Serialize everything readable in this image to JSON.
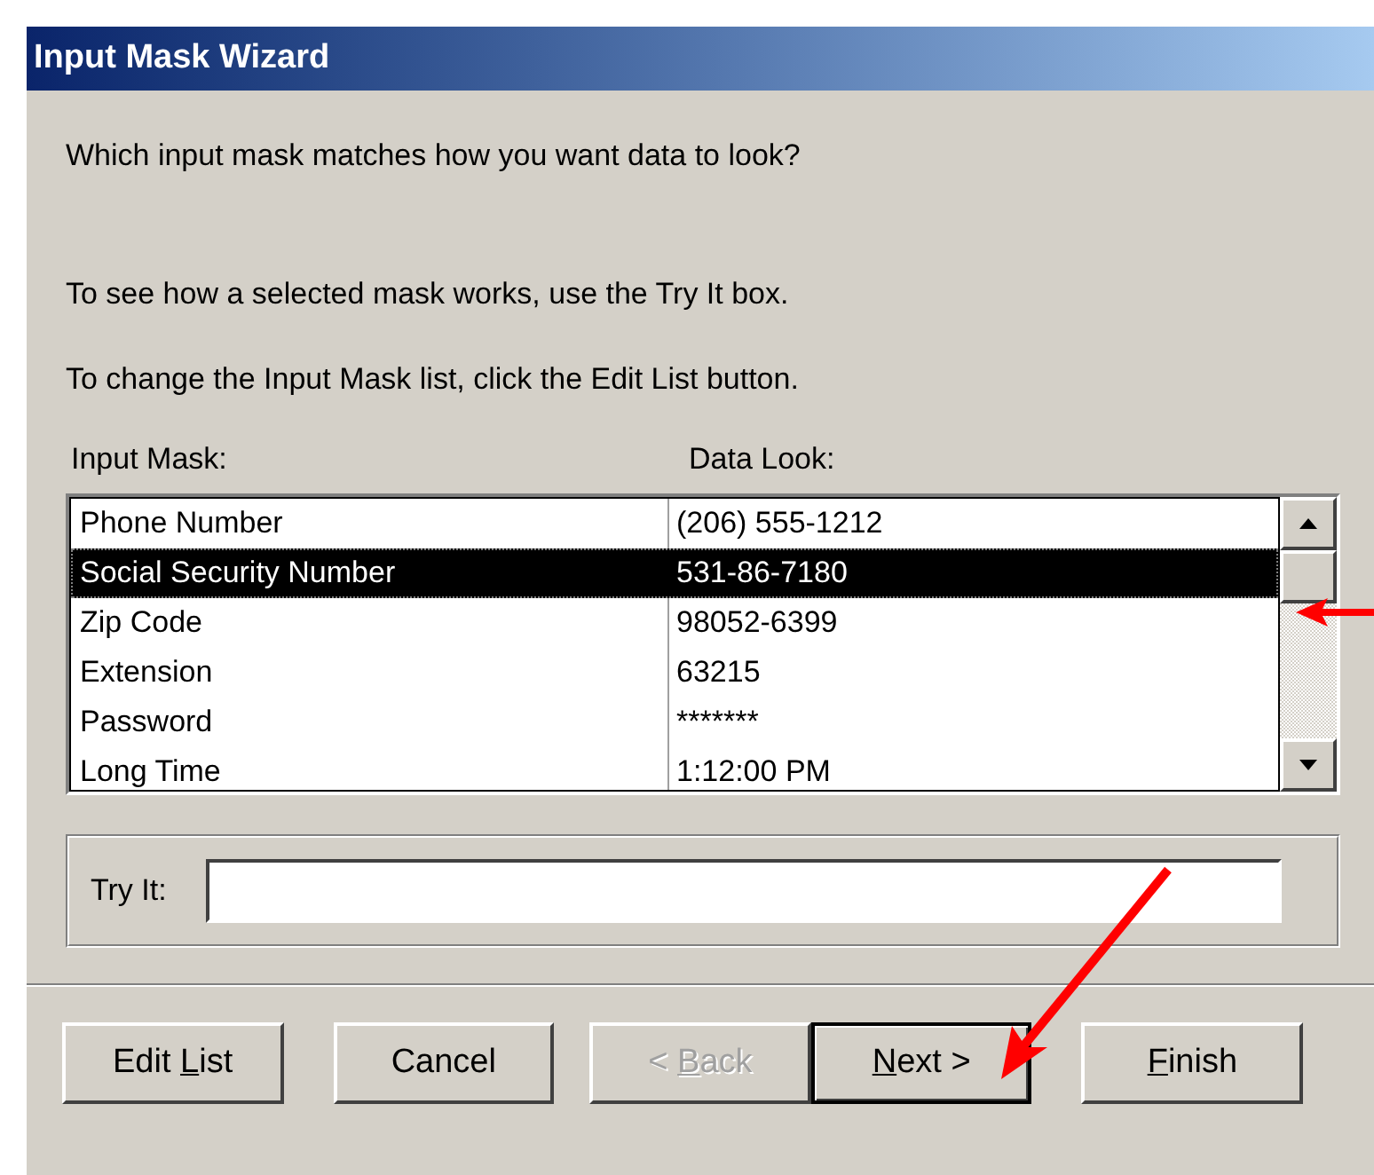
{
  "window": {
    "title": "Input Mask Wizard"
  },
  "question": "Which input mask matches how you want data to look?",
  "hints": [
    "To see how a selected mask works, use the Try It box.",
    "To change the Input Mask list, click the Edit List button."
  ],
  "list": {
    "columns": [
      "Input Mask:",
      "Data Look:"
    ],
    "rows": [
      {
        "mask": "Phone Number",
        "look": "(206) 555-1212",
        "selected": false
      },
      {
        "mask": "Social Security Number",
        "look": "531-86-7180",
        "selected": true
      },
      {
        "mask": "Zip Code",
        "look": "98052-6399",
        "selected": false
      },
      {
        "mask": "Extension",
        "look": "63215",
        "selected": false
      },
      {
        "mask": "Password",
        "look": "*******",
        "selected": false
      },
      {
        "mask": "Long Time",
        "look": "1:12:00 PM",
        "selected": false
      }
    ]
  },
  "try_it": {
    "label": "Try It:"
  },
  "buttons": [
    {
      "before": "Edit ",
      "key": "L",
      "after": "ist",
      "disabled": false,
      "default": false
    },
    {
      "before": "Cancel",
      "disabled": false,
      "default": false
    },
    {
      "before": "< ",
      "key": "B",
      "after": "ack",
      "disabled": true,
      "default": false
    },
    {
      "key": "N",
      "after": "ext >",
      "disabled": false,
      "default": true
    },
    {
      "key": "F",
      "after": "inish",
      "disabled": false,
      "default": false
    }
  ]
}
